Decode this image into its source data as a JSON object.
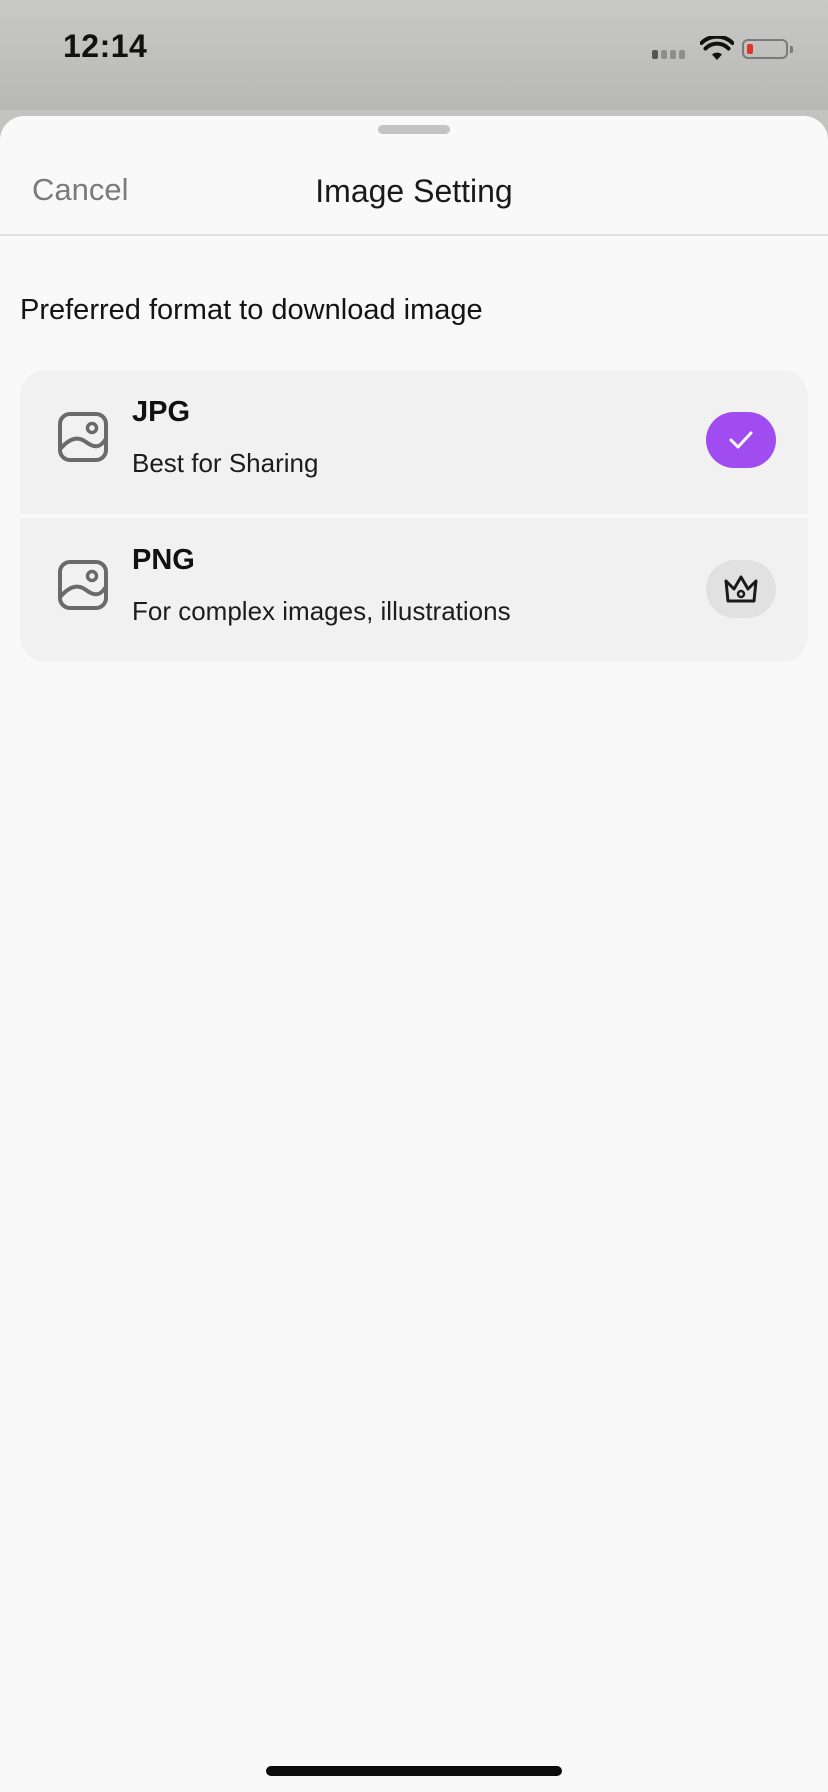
{
  "status_bar": {
    "time": "12:14"
  },
  "sheet": {
    "cancel_label": "Cancel",
    "title": "Image Setting"
  },
  "section": {
    "label": "Preferred format to download image"
  },
  "options": [
    {
      "title": "JPG",
      "subtitle": "Best for Sharing",
      "icon": "image-icon",
      "state": "selected",
      "badge_icon": "checkmark-icon"
    },
    {
      "title": "PNG",
      "subtitle": "For complex images, illustrations",
      "icon": "image-icon",
      "state": "premium",
      "badge_icon": "crown-icon"
    }
  ],
  "colors": {
    "accent": "#a04cf0",
    "sheet_background": "#f9f9f9",
    "option_background": "#f1f1f1",
    "cancel_text": "#7b7b7b",
    "battery_low": "#e0342d"
  }
}
